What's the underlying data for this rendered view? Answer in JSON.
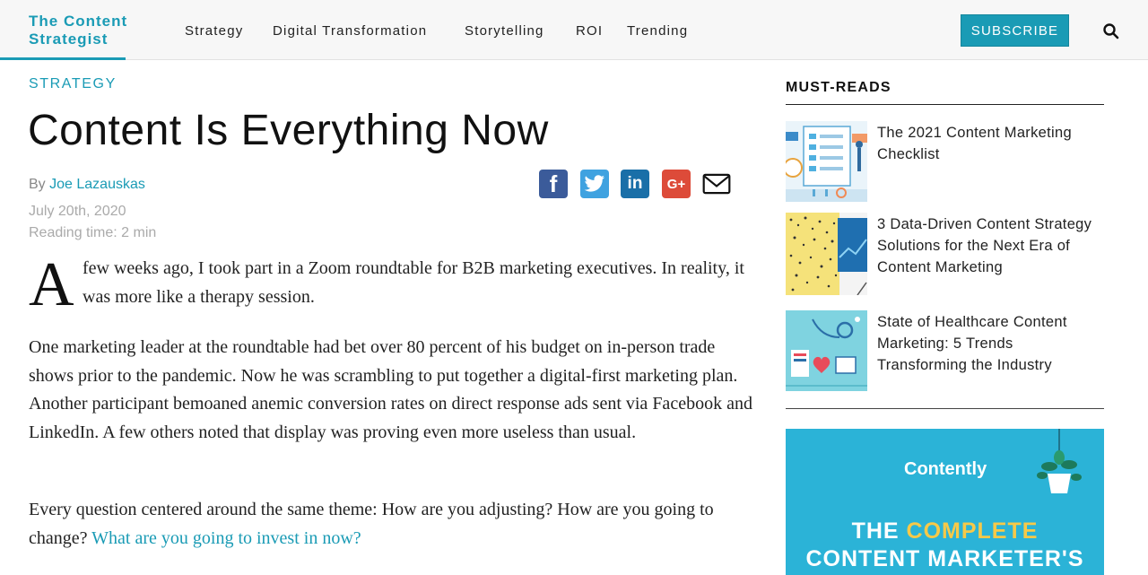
{
  "header": {
    "logo_line1": "The Content",
    "logo_line2": "Strategist",
    "nav": [
      "Strategy",
      "Digital Transformation",
      "Storytelling",
      "ROI",
      "Trending"
    ],
    "subscribe_label": "SUBSCRIBE",
    "brand_color": "#1a9bb5"
  },
  "article": {
    "category": "STRATEGY",
    "title": "Content Is Everything Now",
    "by_prefix": "By",
    "author": "Joe Lazauskas",
    "date": "July 20th, 2020",
    "reading_time": "Reading time: 2 min",
    "share_icons": [
      "facebook-icon",
      "twitter-icon",
      "linkedin-icon",
      "google-plus-icon",
      "email-icon"
    ],
    "dropcap": "A",
    "p1": "few weeks ago, I took part in a Zoom roundtable for B2B marketing executives. In reality, it was more like a therapy session.",
    "p2": "One marketing leader at the roundtable had bet over 80 percent of his budget on in-person trade shows prior to the pandemic. Now he was scrambling to put together a digital-first marketing plan. Another participant bemoaned anemic conversion rates on direct response ads sent via Facebook and LinkedIn. A few others noted that display was proving even more useless than usual.",
    "p3_text": "Every question centered around the same theme: How are you adjusting? How are you going to change?",
    "p3_link": "What are you going to invest in now?"
  },
  "sidebar": {
    "heading": "MUST-READS",
    "items": [
      {
        "title": "The 2021 Content Marketing Checklist"
      },
      {
        "title": "3 Data-Driven Content Strategy Solutions for the Next Era of Content Marketing"
      },
      {
        "title": "State of Healthcare Content Marketing: 5 Trends Transforming the Industry"
      }
    ],
    "ad": {
      "logo": "Contently",
      "line1_a": "THE ",
      "line1_b": "COMPLETE",
      "line2": "CONTENT MARKETER'S"
    }
  }
}
